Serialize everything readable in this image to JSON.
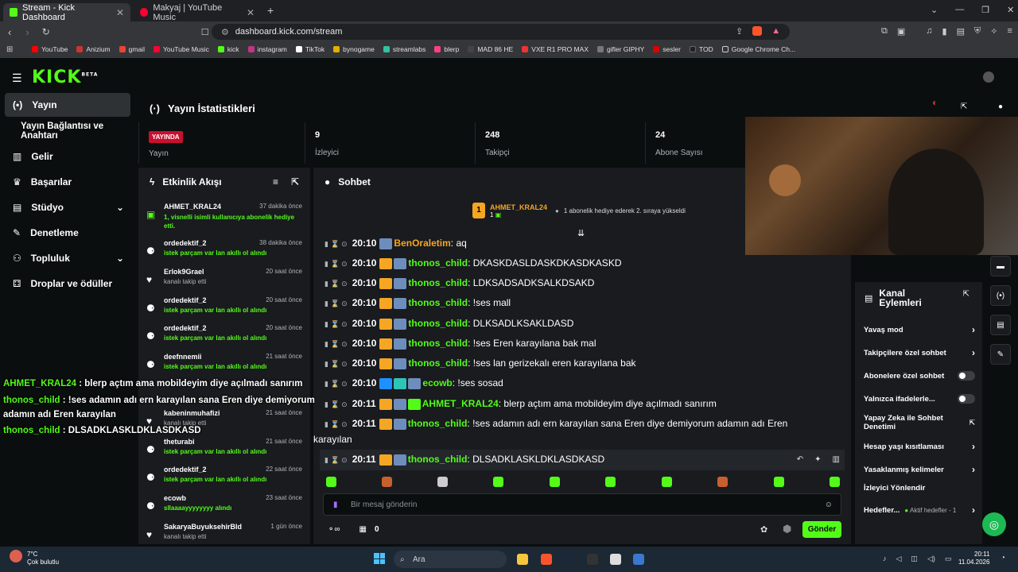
{
  "browser": {
    "tabs": [
      {
        "label": "Stream - Kick Dashboard"
      },
      {
        "label": "Makyaj | YouTube Music"
      }
    ],
    "url": "dashboard.kick.com/stream",
    "bookmarks": [
      "YouTube",
      "Anizium",
      "gmail",
      "YouTube Music",
      "kick",
      "instagram",
      "TikTok",
      "bynogame",
      "streamlabs",
      "blerp",
      "MAD 86 HE",
      "VXE R1 PRO MAX",
      "gifler GIPHY",
      "sesler",
      "TOD",
      "Google Chrome Ch..."
    ]
  },
  "app": {
    "logo": "KICK",
    "logo_sup": "BETA"
  },
  "sidebar": {
    "items": [
      {
        "label": "Yayın",
        "icon": "broadcast-icon"
      },
      {
        "label": "Yayın Bağlantısı ve Anahtarı"
      },
      {
        "label": "Gelir",
        "icon": "chart-icon"
      },
      {
        "label": "Başarılar",
        "icon": "trophy-icon"
      },
      {
        "label": "Stüdyo",
        "icon": "studio-icon"
      },
      {
        "label": "Denetleme",
        "icon": "wrench-icon"
      },
      {
        "label": "Topluluk",
        "icon": "people-icon"
      },
      {
        "label": "Droplar ve ödüller",
        "icon": "drops-icon"
      }
    ]
  },
  "stats": {
    "title": "Yayın İstatistikleri",
    "live_badge": "YAYINDA",
    "live_label": "Yayın",
    "viewers": {
      "value": "9",
      "label": "İzleyici"
    },
    "followers": {
      "value": "248",
      "label": "Takipçi"
    },
    "subs": {
      "value": "24",
      "label": "Abone Sayısı"
    }
  },
  "feed": {
    "title": "Etkinlik Akışı",
    "events": [
      {
        "name": "AHMET_KRAL24",
        "time": "37 dakika önce",
        "desc": "1, visnelli isimli kullanıcıya abonelik hediye etti.",
        "desc2": "etti.",
        "type": "gift"
      },
      {
        "name": "ordedektif_2",
        "time": "38 dakika önce",
        "desc": "istek parçam var lan akıllı ol alındı",
        "type": "redeem"
      },
      {
        "name": "Erlok9Grael",
        "time": "20 saat önce",
        "desc": "kanalı takip etti",
        "type": "follow"
      },
      {
        "name": "ordedektif_2",
        "time": "20 saat önce",
        "desc": "istek parçam var lan akıllı ol alındı",
        "type": "redeem"
      },
      {
        "name": "ordedektif_2",
        "time": "20 saat önce",
        "desc": "istek parçam var lan akıllı ol alındı",
        "type": "redeem"
      },
      {
        "name": "deefnnemii",
        "time": "21 saat önce",
        "desc": "istek parçam var lan akıllı ol alındı",
        "type": "redeem"
      },
      {
        "name": "kabeninmuhafizi",
        "time": "21 saat önce",
        "desc": "kanalı takip etti",
        "type": "follow"
      },
      {
        "name": "theturabi",
        "time": "21 saat önce",
        "desc": "istek parçam var lan akıllı ol alındı",
        "type": "redeem"
      },
      {
        "name": "ordedektif_2",
        "time": "22 saat önce",
        "desc": "istek parçam var lan akıllı ol alındı",
        "type": "redeem"
      },
      {
        "name": "ecowb",
        "time": "23 saat önce",
        "desc": "sllaaaayyyyyyyy alındı",
        "type": "redeem"
      },
      {
        "name": "SakaryaBuyuksehirBld",
        "time": "1 gün önce",
        "desc": "kanalı takip etti",
        "type": "follow"
      }
    ]
  },
  "chat": {
    "title": "Sohbet",
    "pinned": {
      "name": "AHMET_KRAL24",
      "count": "1",
      "text": "1 abonelik hediye ederek 2. sıraya yükseldi"
    },
    "messages": [
      {
        "time": "20:10",
        "user": "BenOraletim",
        "text": "aq",
        "color": "#f5a623"
      },
      {
        "time": "20:10",
        "user": "thonos_child",
        "text": "DKASKDASLDASKDKASDKASKD",
        "color": "#53fc18"
      },
      {
        "time": "20:10",
        "user": "thonos_child",
        "text": "LDKSADSADKSALKDSAKD",
        "color": "#53fc18"
      },
      {
        "time": "20:10",
        "user": "thonos_child",
        "text": "!ses mall",
        "color": "#53fc18"
      },
      {
        "time": "20:10",
        "user": "thonos_child",
        "text": "DLKSADLKSAKLDASD",
        "color": "#53fc18"
      },
      {
        "time": "20:10",
        "user": "thonos_child",
        "text": "!ses Eren karayılana bak mal",
        "color": "#53fc18"
      },
      {
        "time": "20:10",
        "user": "thonos_child",
        "text": "!ses lan gerizekalı eren karayılana bak",
        "color": "#53fc18"
      },
      {
        "time": "20:10",
        "user": "ecowb",
        "text": "!ses sosad",
        "color": "#53fc18"
      },
      {
        "time": "20:11",
        "user": "AHMET_KRAL24",
        "text": "blerp açtım ama mobildeyim diye açılmadı sanırım",
        "color": "#53fc18"
      },
      {
        "time": "20:11",
        "user": "thonos_child",
        "text": "!ses adamın adı ern karayılan sana Eren diye demiyorum adamın adı Eren",
        "text2": "karayılan",
        "color": "#53fc18"
      },
      {
        "time": "20:11",
        "user": "thonos_child",
        "text": "DLSADKLASKLDKLASDKASD",
        "color": "#53fc18"
      }
    ],
    "input_placeholder": "Bir mesaj gönderin",
    "points": "0",
    "send_label": "Gönder"
  },
  "overlay": [
    {
      "user": "AHMET_KRAL24",
      "text": "blerp açtım ama mobildeyim diye açılmadı sanırım"
    },
    {
      "user": "thonos_child",
      "text": "!ses adamın adı ern karayılan sana Eren diye demiyorum",
      "text2": "adamın adı Eren karayılan"
    },
    {
      "user": "thonos_child",
      "text": "DLSADKLASKLDKLASDKASD"
    }
  ],
  "actions": {
    "title": "Kanal Eylemleri",
    "items": [
      {
        "label": "Yavaş mod",
        "kind": "arrow"
      },
      {
        "label": "Takipçilere özel sohbet",
        "kind": "arrow"
      },
      {
        "label": "Abonelere özel sohbet",
        "kind": "toggle"
      },
      {
        "label": "Yalnızca ifadelerle...",
        "kind": "toggle"
      },
      {
        "label": "Yapay Zeka ile Sohbet Denetimi",
        "kind": "external"
      },
      {
        "label": "Hesap yaşı kısıtlaması",
        "kind": "arrow"
      },
      {
        "label": "Yasaklanmış kelimeler",
        "kind": "arrow"
      },
      {
        "label": "İzleyici Yönlendir",
        "kind": "none"
      },
      {
        "label": "Hedefler...",
        "kind": "arrow",
        "sub": "Aktif hedefler - 1"
      }
    ]
  },
  "taskbar": {
    "weather_temp": "7°C",
    "weather_desc": "Çok bulutlu",
    "search": "Ara",
    "time": "20:11",
    "date": "11.04.2026"
  }
}
